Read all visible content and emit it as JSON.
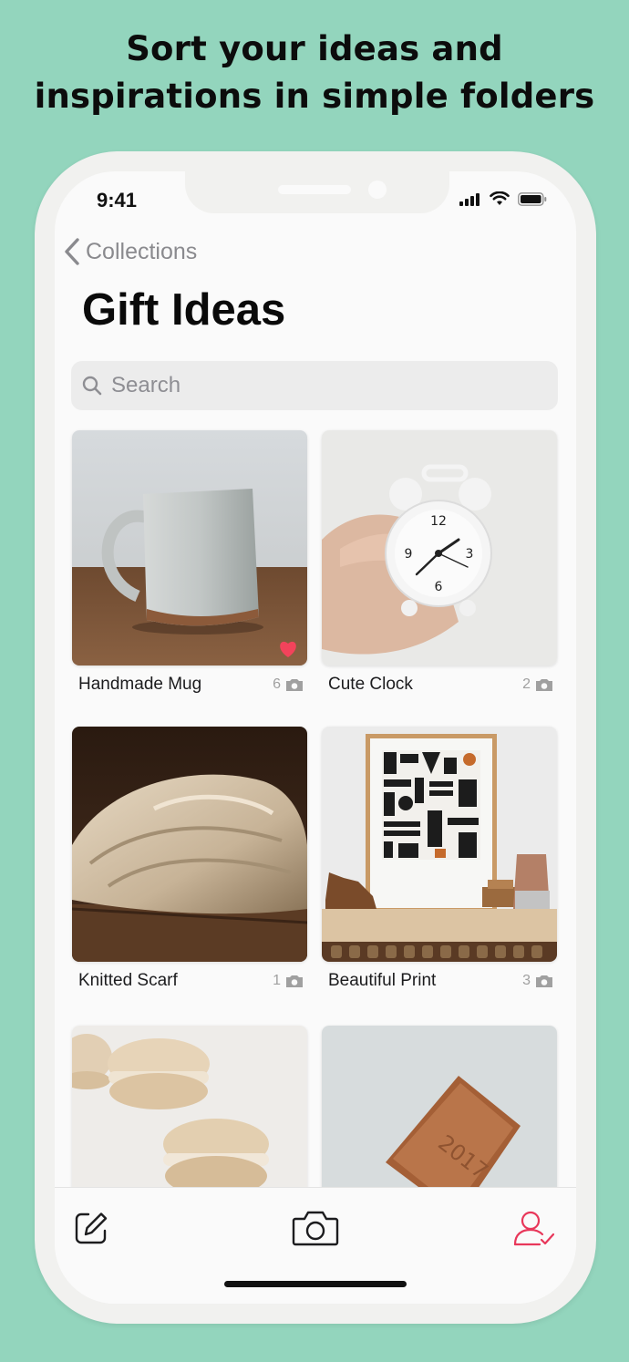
{
  "headline": [
    "Sort your ideas and",
    "inspirations in simple folders"
  ],
  "status": {
    "time": "9:41"
  },
  "nav": {
    "back_label": "Collections",
    "title": "Gift Ideas"
  },
  "search": {
    "placeholder": "Search"
  },
  "items": [
    {
      "name": "Handmade Mug",
      "count": "6",
      "favorite": true
    },
    {
      "name": "Cute Clock",
      "count": "2",
      "favorite": false
    },
    {
      "name": "Knitted Scarf",
      "count": "1",
      "favorite": false
    },
    {
      "name": "Beautiful Print",
      "count": "3",
      "favorite": false
    },
    {
      "name": "",
      "count": ""
    },
    {
      "name": "",
      "count": ""
    }
  ],
  "tabbar": {
    "icons": [
      "compose-icon",
      "camera-icon",
      "user-check-icon"
    ]
  },
  "colors": {
    "background": "#93d5bd",
    "accent": "#e8375a",
    "heart": "#f2435b"
  }
}
